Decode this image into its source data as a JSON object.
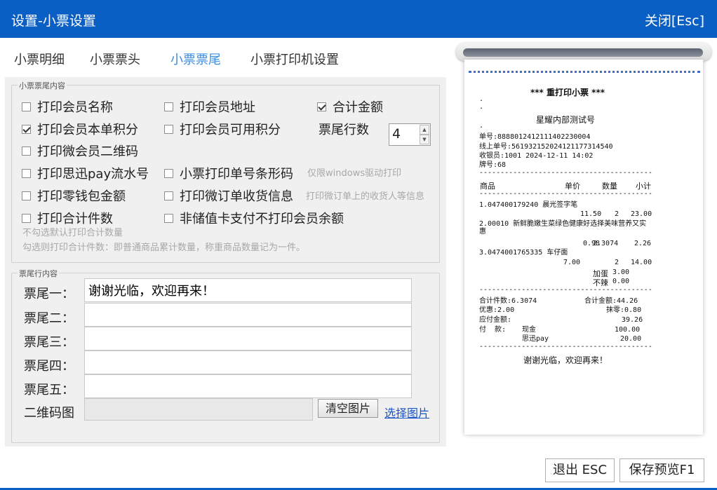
{
  "window": {
    "title": "设置-小票设置",
    "close_label": "关闭[Esc]"
  },
  "tabs": [
    "小票明细",
    "小票票头",
    "小票票尾",
    "小票打印机设置"
  ],
  "active_tab": 2,
  "footer_content": {
    "legend": "小票票尾内容",
    "options": {
      "member_name": {
        "label": "打印会员名称",
        "checked": false
      },
      "member_address": {
        "label": "打印会员地址",
        "checked": false
      },
      "total_amount": {
        "label": "合计金额",
        "checked": true
      },
      "member_points_order": {
        "label": "打印会员本单积分",
        "checked": true
      },
      "member_points_available": {
        "label": "打印会员可用积分",
        "checked": false
      },
      "wechat_member_qr": {
        "label": "打印微会员二维码",
        "checked": false
      },
      "sixun_pay_serial": {
        "label": "打印思迅pay流水号",
        "checked": false
      },
      "receipt_barcode": {
        "label": "小票打印单号条形码",
        "checked": false
      },
      "wallet_amount": {
        "label": "打印零钱包金额",
        "checked": false
      },
      "wechat_order_receiver": {
        "label": "打印微订单收货信息",
        "checked": false
      },
      "total_count": {
        "label": "打印合计件数",
        "checked": false
      },
      "non_stored_card_no_balance": {
        "label": "非储值卡支付不打印会员余额",
        "checked": false
      }
    },
    "hints": {
      "barcode": "仅限windows驱动打印",
      "receiver": "打印微订单上的收货人等信息",
      "count_unchecked": "不勾选默认打印合计数量",
      "count_checked": "勾选则打印合计件数：即普通商品累计数量，称重商品数量记为一件。"
    },
    "footer_rows_label": "票尾行数",
    "footer_rows_value": "4"
  },
  "footer_lines": {
    "legend": "票尾行内容",
    "lines": [
      {
        "label": "票尾一：",
        "value": "谢谢光临，欢迎再来！"
      },
      {
        "label": "票尾二：",
        "value": ""
      },
      {
        "label": "票尾三：",
        "value": ""
      },
      {
        "label": "票尾四：",
        "value": ""
      },
      {
        "label": "票尾五：",
        "value": ""
      }
    ],
    "qr_label": "二维码图",
    "clear_image_label": "清空图片",
    "select_image_label": "选择图片"
  },
  "buttons": {
    "exit": "退出 ESC",
    "save_preview": "保存预览F1"
  },
  "receipt": {
    "title": "*** 重打印小票 ***",
    "store": "星耀内部测试号",
    "order_no": "单号:88880124121114022300​04",
    "online_no": "线上单号:5619321520241211773145​40",
    "cashier": "收银员:1001 2024-12-11 14:02",
    "card_no": "牌号:68",
    "headers": {
      "item": "商品",
      "price": "单价",
      "qty": "数量",
      "subtotal": "小计"
    },
    "items": [
      {
        "name": "1.047400179240 晨光签字笔",
        "price": "11.50",
        "qty": "2",
        "subtotal": "23.00"
      },
      {
        "name": "2.00010 新鲜脆嫩生菜绿色健康好选择美味营养又实惠",
        "price": "0.98",
        "qty": "2.3074",
        "subtotal": "2.26"
      },
      {
        "name": "3.0474001765335 车仔面",
        "price": "7.00",
        "qty": "2",
        "subtotal": "14.00"
      }
    ],
    "addons": [
      {
        "name": "加蛋",
        "amount": "3.00"
      },
      {
        "name": "不辣",
        "amount": "0.00"
      }
    ],
    "summary": {
      "count": "合计件数:6.3074",
      "total": "合计金额:44.26",
      "discount": "优惠:2.00",
      "rounding": "抹零:0.80",
      "payable_label": "应付金额:",
      "payable": "39.26",
      "pay_label": "付  款:",
      "pay1_method": "现金",
      "pay1_amount": "100.00",
      "pay2_method": "思迅pay",
      "pay2_amount": "20.00"
    },
    "footer": "谢谢光临，欢迎再来！"
  }
}
